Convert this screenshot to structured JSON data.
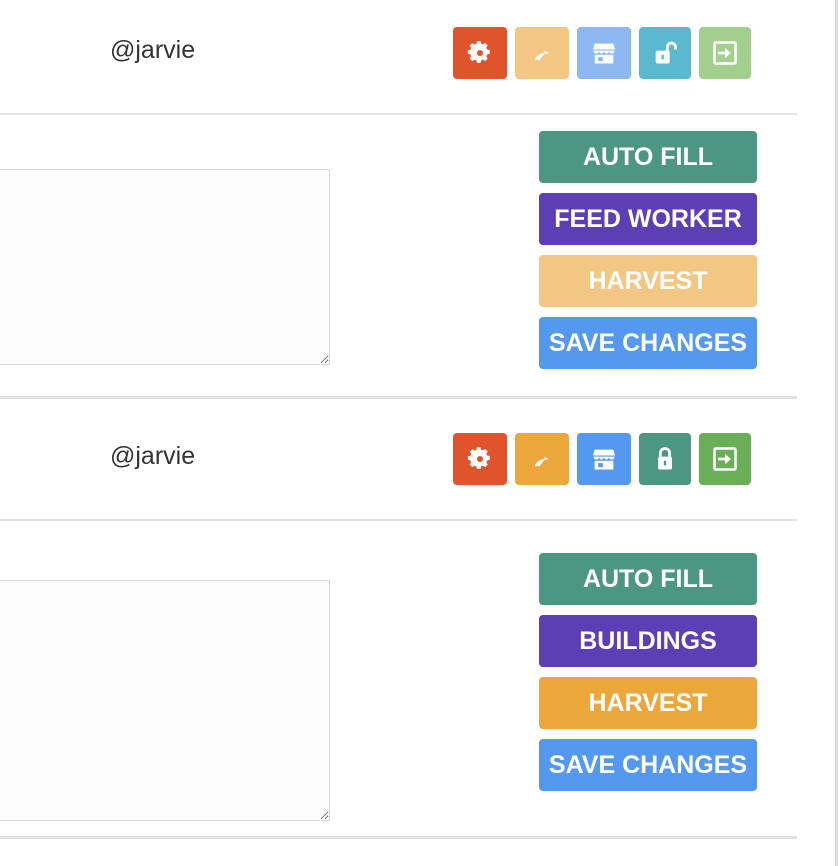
{
  "cards": [
    {
      "username": "@jarvie",
      "icons": [
        {
          "name": "gear-icon",
          "color": "#e0542b"
        },
        {
          "name": "pickaxe-icon",
          "color": "#f2c784"
        },
        {
          "name": "store-icon",
          "color": "#8cb7f0"
        },
        {
          "name": "unlock-icon",
          "color": "#5ab8cf"
        },
        {
          "name": "exit-icon",
          "color": "#a3cf8e"
        }
      ],
      "textarea_value": "",
      "actions": [
        {
          "label": "AUTO FILL",
          "color": "#4d9682"
        },
        {
          "label": "FEED WORKER",
          "color": "#5c3fb4"
        },
        {
          "label": "HARVEST",
          "color": "#f2c784"
        },
        {
          "label": "SAVE CHANGES",
          "color": "#5598ef"
        }
      ]
    },
    {
      "username": "@jarvie",
      "icons": [
        {
          "name": "gear-icon",
          "color": "#e0542b"
        },
        {
          "name": "pickaxe-icon",
          "color": "#eca73c"
        },
        {
          "name": "store-icon",
          "color": "#5598ef"
        },
        {
          "name": "lock-icon",
          "color": "#4d9682"
        },
        {
          "name": "exit-icon",
          "color": "#6aaf57"
        }
      ],
      "textarea_value": "",
      "actions": [
        {
          "label": "AUTO FILL",
          "color": "#4d9682"
        },
        {
          "label": "BUILDINGS",
          "color": "#5c3fb4"
        },
        {
          "label": "HARVEST",
          "color": "#eca73c"
        },
        {
          "label": "SAVE CHANGES",
          "color": "#5598ef"
        }
      ]
    }
  ]
}
